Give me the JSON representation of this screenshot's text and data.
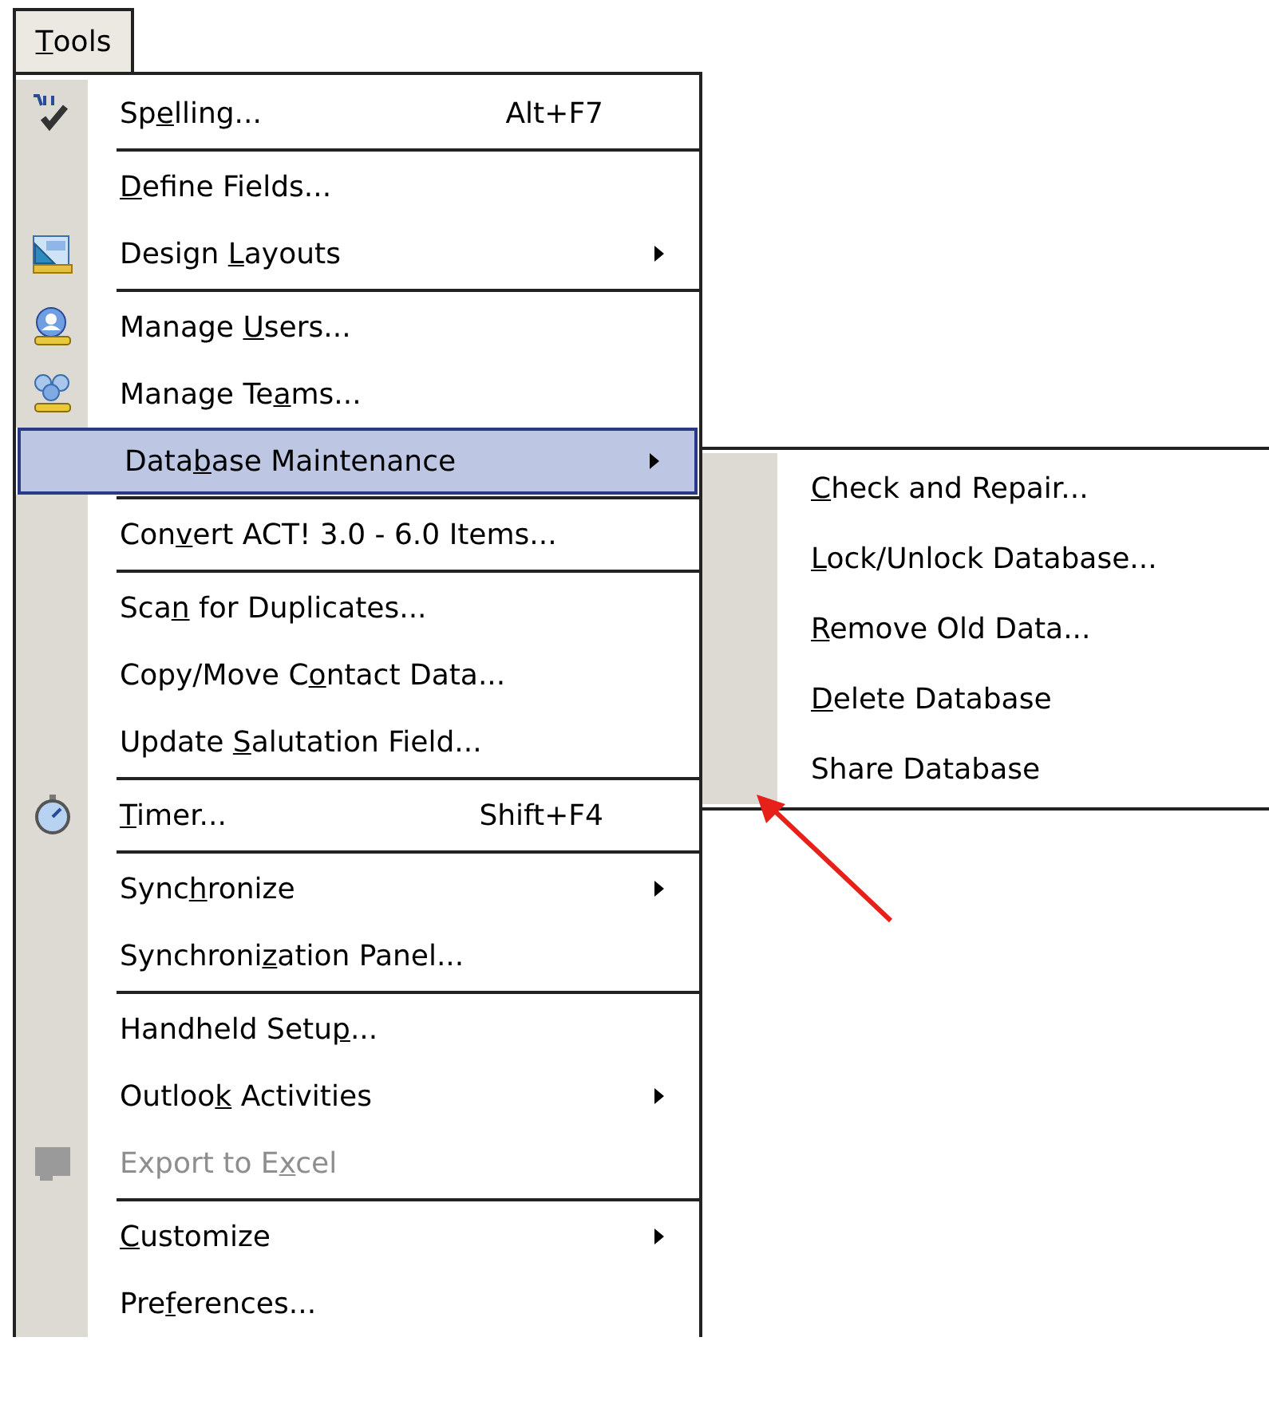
{
  "menu_bar": {
    "label": [
      "T",
      "ools"
    ],
    "key_first": true,
    "selected": true
  },
  "menu": {
    "items": [
      {
        "kind": "item",
        "label": [
          "Sp",
          "e",
          "lling..."
        ],
        "shortcut": "Alt+F7",
        "icon": true,
        "submenu": false,
        "selected": false,
        "disabled": false
      },
      {
        "kind": "separator"
      },
      {
        "kind": "item",
        "label": [
          "D",
          "efine Fields..."
        ],
        "key_first": true,
        "icon": false,
        "submenu": false,
        "selected": false,
        "disabled": false
      },
      {
        "kind": "item",
        "label": [
          "Design ",
          "L",
          "ayouts"
        ],
        "icon": true,
        "submenu": true,
        "selected": false,
        "disabled": false
      },
      {
        "kind": "separator"
      },
      {
        "kind": "item",
        "label": [
          "Manage ",
          "U",
          "sers..."
        ],
        "icon": true,
        "submenu": false,
        "selected": false,
        "disabled": false
      },
      {
        "kind": "item",
        "label": [
          "Manage Te",
          "a",
          "ms..."
        ],
        "icon": true,
        "submenu": false,
        "selected": false,
        "disabled": false
      },
      {
        "kind": "item",
        "label": [
          "Data",
          "b",
          "ase Maintenance"
        ],
        "icon": false,
        "submenu": true,
        "selected": true,
        "disabled": false
      },
      {
        "kind": "separator"
      },
      {
        "kind": "item",
        "label": [
          "Con",
          "v",
          "ert ACT! 3.0 - 6.0 Items..."
        ],
        "icon": false,
        "submenu": false,
        "selected": false,
        "disabled": false
      },
      {
        "kind": "separator"
      },
      {
        "kind": "item",
        "label": [
          "Sca",
          "n",
          " for Duplicates..."
        ],
        "icon": false,
        "submenu": false,
        "selected": false,
        "disabled": false
      },
      {
        "kind": "item",
        "label": [
          "Copy/Move C",
          "o",
          "ntact Data..."
        ],
        "icon": false,
        "submenu": false,
        "selected": false,
        "disabled": false
      },
      {
        "kind": "item",
        "label": [
          "Update ",
          "S",
          "alutation Field..."
        ],
        "icon": false,
        "submenu": false,
        "selected": false,
        "disabled": false
      },
      {
        "kind": "separator"
      },
      {
        "kind": "item",
        "label": [
          "T",
          "imer..."
        ],
        "key_first": true,
        "shortcut": "Shift+F4",
        "icon": true,
        "submenu": false,
        "selected": false,
        "disabled": false
      },
      {
        "kind": "separator"
      },
      {
        "kind": "item",
        "label": [
          "Sync",
          "h",
          "ronize"
        ],
        "icon": false,
        "submenu": true,
        "selected": false,
        "disabled": false
      },
      {
        "kind": "item",
        "label": [
          "Synchroni",
          "z",
          "ation Panel..."
        ],
        "icon": false,
        "submenu": false,
        "selected": false,
        "disabled": false
      },
      {
        "kind": "separator"
      },
      {
        "kind": "item",
        "label": [
          "Handheld Setu",
          "p",
          "..."
        ],
        "icon": false,
        "submenu": false,
        "selected": false,
        "disabled": false
      },
      {
        "kind": "item",
        "label": [
          "Outloo",
          "k",
          " Activities"
        ],
        "icon": false,
        "submenu": true,
        "selected": false,
        "disabled": false
      },
      {
        "kind": "item",
        "label": [
          "Export to E",
          "x",
          "cel"
        ],
        "icon": true,
        "submenu": false,
        "selected": false,
        "disabled": true
      },
      {
        "kind": "separator"
      },
      {
        "kind": "item",
        "label": [
          "C",
          "ustomize"
        ],
        "key_first": true,
        "icon": false,
        "submenu": true,
        "selected": false,
        "disabled": false
      },
      {
        "kind": "item",
        "label": [
          "Pre",
          "f",
          "erences..."
        ],
        "icon": false,
        "submenu": false,
        "selected": false,
        "disabled": false
      }
    ]
  },
  "submenu": {
    "items": [
      {
        "kind": "item",
        "label": [
          "C",
          "heck and Repair..."
        ],
        "key_first": true,
        "selected": false,
        "disabled": false
      },
      {
        "kind": "item",
        "label": [
          "L",
          "ock/Unlock Database..."
        ],
        "key_first": true,
        "selected": false,
        "disabled": false
      },
      {
        "kind": "item",
        "label": [
          "R",
          "emove Old Data..."
        ],
        "key_first": true,
        "selected": false,
        "disabled": false
      },
      {
        "kind": "item",
        "label": [
          "D",
          "elete Database"
        ],
        "key_first": true,
        "selected": false,
        "disabled": false
      },
      {
        "kind": "item",
        "label": [
          "Share Database"
        ],
        "selected": false,
        "disabled": false
      }
    ]
  },
  "annotation": {
    "kind": "arrow"
  }
}
